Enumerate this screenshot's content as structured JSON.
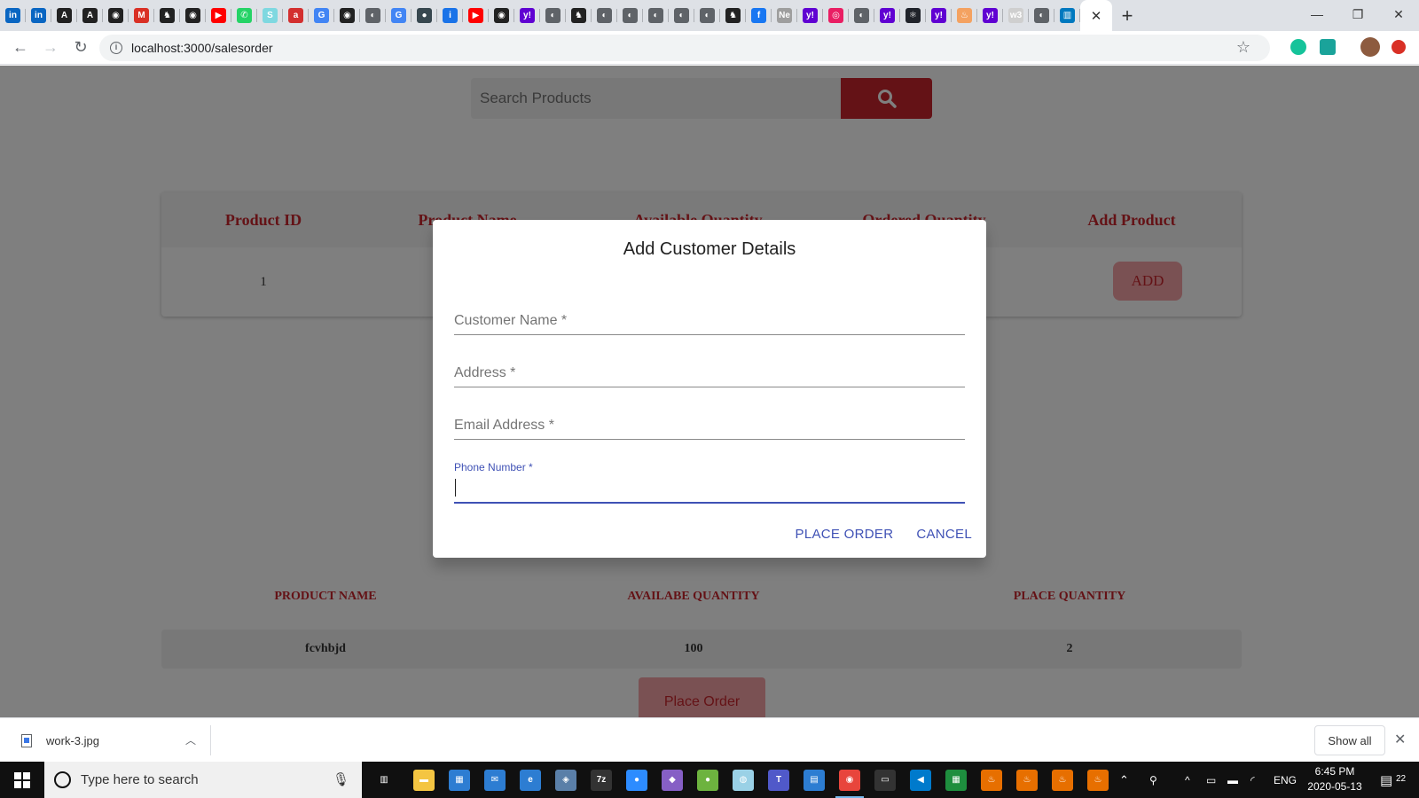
{
  "browser": {
    "active_tab_close": "✕",
    "new_tab": "+",
    "url": "localhost:3000/salesorder",
    "favicons": [
      {
        "icon": "linkedin-icon",
        "glyph": "in",
        "color": "#0a66c2"
      },
      {
        "icon": "linkedin-icon",
        "glyph": "in",
        "color": "#0a66c2"
      },
      {
        "icon": "font-icon",
        "glyph": "A",
        "color": "#222222"
      },
      {
        "icon": "font-icon",
        "glyph": "A",
        "color": "#222222"
      },
      {
        "icon": "github-icon",
        "glyph": "◉",
        "color": "#222222"
      },
      {
        "icon": "gmail-icon",
        "glyph": "M",
        "color": "#d93025"
      },
      {
        "icon": "animal-icon",
        "glyph": "♞",
        "color": "#222222"
      },
      {
        "icon": "github-icon",
        "glyph": "◉",
        "color": "#222222"
      },
      {
        "icon": "youtube-icon",
        "glyph": "▶",
        "color": "#ff0000"
      },
      {
        "icon": "whatsapp-icon",
        "glyph": "✆",
        "color": "#25d366"
      },
      {
        "icon": "skype-icon",
        "glyph": "S",
        "color": "#7fd8e0"
      },
      {
        "icon": "app-icon",
        "glyph": "a",
        "color": "#d32f2f"
      },
      {
        "icon": "google-icon",
        "glyph": "G",
        "color": "#4285f4"
      },
      {
        "icon": "github-icon",
        "glyph": "◉",
        "color": "#222222"
      },
      {
        "icon": "globe-icon",
        "glyph": "◐",
        "color": "#5f6368"
      },
      {
        "icon": "google-icon",
        "glyph": "G",
        "color": "#4285f4"
      },
      {
        "icon": "site-icon",
        "glyph": "●",
        "color": "#37474f"
      },
      {
        "icon": "info-icon",
        "glyph": "i",
        "color": "#1a73e8"
      },
      {
        "icon": "youtube-icon",
        "glyph": "▶",
        "color": "#ff0000"
      },
      {
        "icon": "github-icon",
        "glyph": "◉",
        "color": "#222222"
      },
      {
        "icon": "yahoo-icon",
        "glyph": "y!",
        "color": "#6001d2"
      },
      {
        "icon": "globe-icon",
        "glyph": "◐",
        "color": "#5f6368"
      },
      {
        "icon": "animal-icon",
        "glyph": "♞",
        "color": "#222222"
      },
      {
        "icon": "globe-icon",
        "glyph": "◐",
        "color": "#5f6368"
      },
      {
        "icon": "globe-icon",
        "glyph": "◐",
        "color": "#5f6368"
      },
      {
        "icon": "globe-icon",
        "glyph": "◐",
        "color": "#5f6368"
      },
      {
        "icon": "globe-icon",
        "glyph": "◐",
        "color": "#5f6368"
      },
      {
        "icon": "globe-icon",
        "glyph": "◐",
        "color": "#5f6368"
      },
      {
        "icon": "animal-icon",
        "glyph": "♞",
        "color": "#222222"
      },
      {
        "icon": "facebook-icon",
        "glyph": "f",
        "color": "#1877f2"
      },
      {
        "icon": "site-icon",
        "glyph": "Ne",
        "color": "#9e9e9e"
      },
      {
        "icon": "yahoo-icon",
        "glyph": "y!",
        "color": "#6001d2"
      },
      {
        "icon": "app-icon",
        "glyph": "◎",
        "color": "#e91e63"
      },
      {
        "icon": "globe-icon",
        "glyph": "◐",
        "color": "#5f6368"
      },
      {
        "icon": "yahoo-icon",
        "glyph": "y!",
        "color": "#6001d2"
      },
      {
        "icon": "react-icon",
        "glyph": "⚛",
        "color": "#20232a"
      },
      {
        "icon": "yahoo-icon",
        "glyph": "y!",
        "color": "#6001d2"
      },
      {
        "icon": "fire-icon",
        "glyph": "♨",
        "color": "#f4a261"
      },
      {
        "icon": "yahoo-icon",
        "glyph": "y!",
        "color": "#6001d2"
      },
      {
        "icon": "w3-icon",
        "glyph": "w3",
        "color": "#cfcfcf"
      },
      {
        "icon": "globe-icon",
        "glyph": "◐",
        "color": "#5f6368"
      },
      {
        "icon": "trello-icon",
        "glyph": "▥",
        "color": "#0079bf"
      }
    ]
  },
  "page": {
    "search_placeholder": "Search Products",
    "product_table": {
      "headers": [
        "Product ID",
        "Product Name",
        "Available Quantity",
        "Ordered Quantity",
        "Add Product"
      ],
      "row": {
        "id": "1",
        "add_label": "ADD"
      }
    },
    "order_table": {
      "headers": [
        "PRODUCT NAME",
        "AVAILABE QUANTITY",
        "PLACE QUANTITY"
      ],
      "row": [
        "fcvhbjd",
        "100",
        "2"
      ]
    },
    "place_order_button": "Place Order"
  },
  "dialog": {
    "title": "Add Customer Details",
    "fields": {
      "customer_name": "Customer Name *",
      "address": "Address *",
      "email": "Email Address *",
      "phone": "Phone Number *"
    },
    "place_order": "PLACE ORDER",
    "cancel": "CANCEL"
  },
  "downloads": {
    "file_name": "work-3.jpg",
    "show_all": "Show all"
  },
  "taskbar": {
    "search_placeholder": "Type here to search",
    "language": "ENG",
    "time": "6:45 PM",
    "date": "2020-05-13",
    "notification_count": "22"
  }
}
